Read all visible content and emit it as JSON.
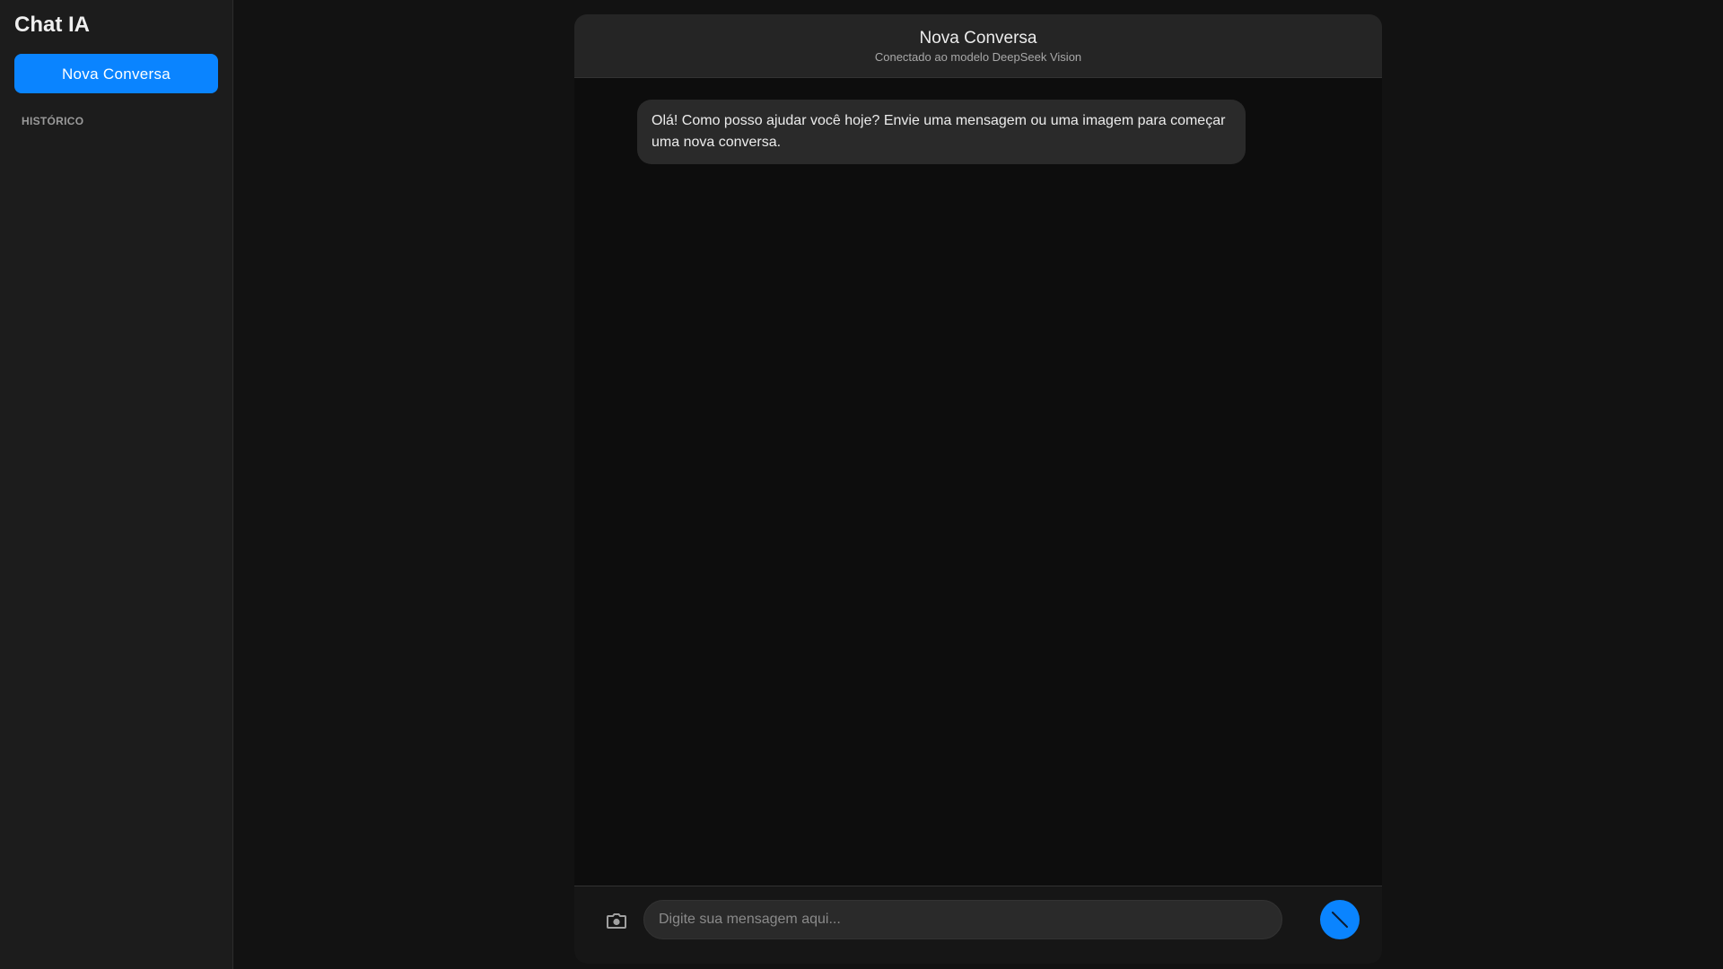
{
  "sidebar": {
    "title": "Chat IA",
    "new_chat_label": "Nova Conversa",
    "history_label": "HISTÓRICO"
  },
  "chat": {
    "title": "Nova Conversa",
    "subtitle": "Conectado ao modelo DeepSeek Vision",
    "messages": [
      {
        "role": "assistant",
        "text": "Olá! Como posso ajudar você hoje? Envie uma mensagem ou uma imagem para começar uma nova conversa."
      }
    ]
  },
  "composer": {
    "placeholder": "Digite sua mensagem aqui...",
    "value": "",
    "camera_icon": "camera-icon",
    "send_icon": "send-icon"
  },
  "colors": {
    "accent": "#0a84ff",
    "background": "#121212",
    "sidebar": "#1c1c1c",
    "bubble": "#2a2a2a"
  }
}
